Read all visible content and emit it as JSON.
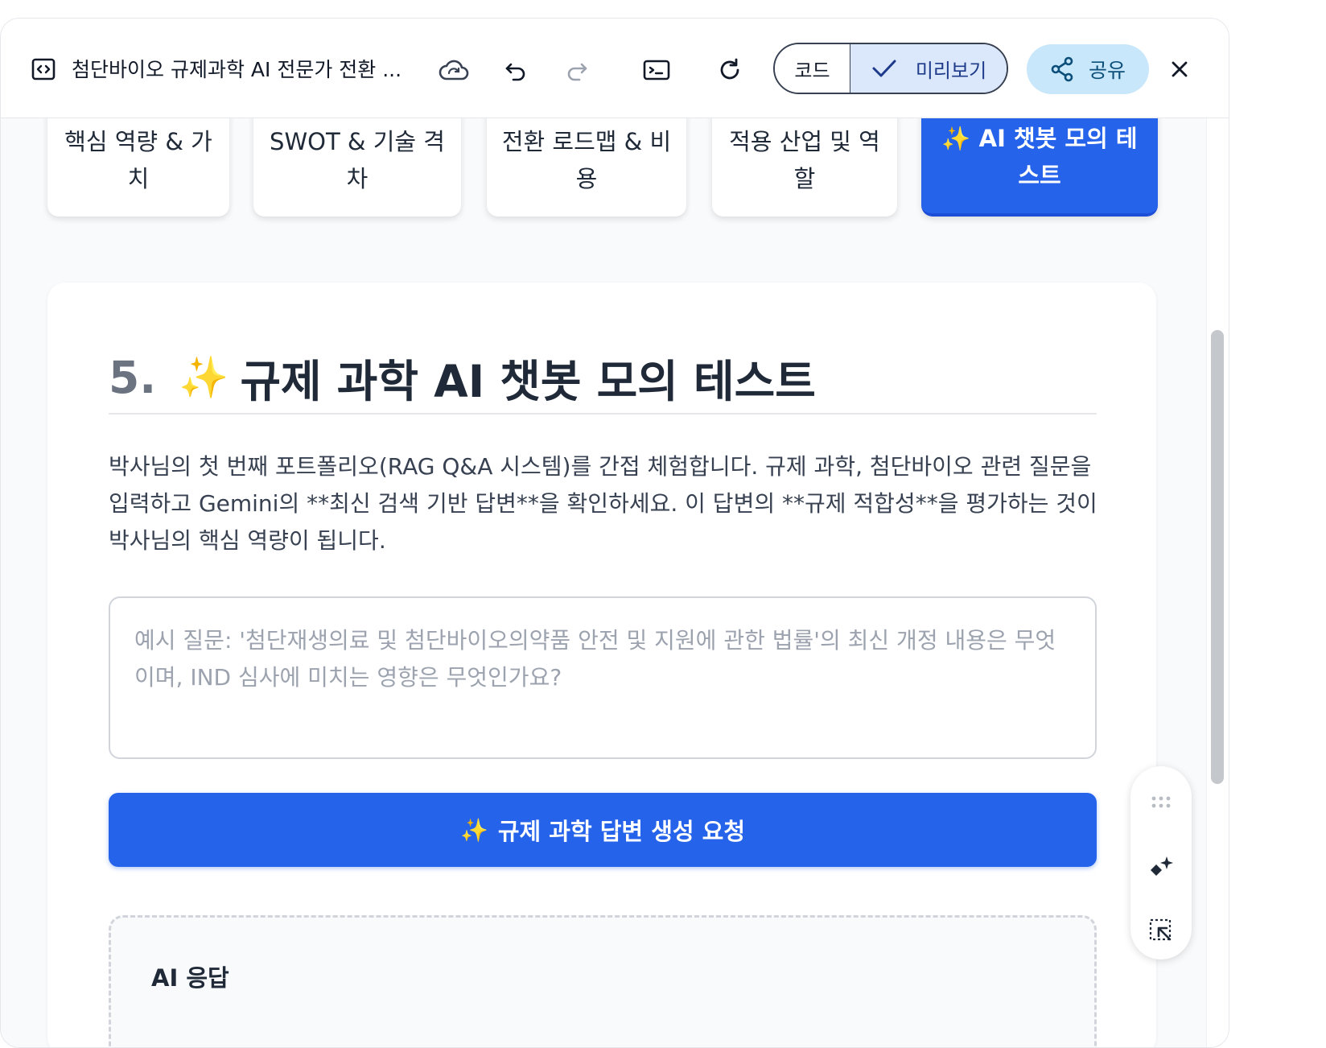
{
  "toolbar": {
    "doc_title": "첨단바이오 규제과학 AI 전문가 전환 ...",
    "code_label": "코드",
    "preview_label": "미리보기",
    "share_label": "공유"
  },
  "tabs": [
    {
      "label": "핵심 역량 & 가치"
    },
    {
      "label": "SWOT & 기술 격차"
    },
    {
      "label": "전환 로드맵 & 비용"
    },
    {
      "label": "적용 산업 및 역할"
    },
    {
      "label": "✨ AI 챗봇 모의 테스트",
      "active": true
    }
  ],
  "section": {
    "number": "5.",
    "sparkle": "✨",
    "title": "규제 과학 AI 챗봇 모의 테스트",
    "description": "박사님의 첫 번째 포트폴리오(RAG Q&A 시스템)를 간접 체험합니다. 규제 과학, 첨단바이오 관련 질문을 입력하고 Gemini의 **최신 검색 기반 답변**을 확인하세요. 이 답변의 **규제 적합성**을 평가하는 것이 박사님의 핵심 역량이 됩니다.",
    "input_placeholder": "예시 질문: '첨단재생의료 및 첨단바이오의약품 안전 및 지원에 관한 법률'의 최신 개정 내용은 무엇이며, IND 심사에 미치는 영향은 무엇인가요?",
    "generate_button_icon": "✨",
    "generate_button_label": "규제 과학 답변 생성 요청",
    "response_title": "AI 응답"
  },
  "colors": {
    "accent": "#2563eb",
    "preview_bg": "#dbe7fb",
    "share_bg": "#c9e7fb",
    "sparkle": "#f5b820"
  },
  "icons": [
    "code-file-icon",
    "cloud-sync-icon",
    "undo-icon",
    "redo-icon",
    "terminal-icon",
    "refresh-icon",
    "check-icon",
    "share-icon",
    "close-icon",
    "drag-handle-icon",
    "ai-sparkle-icon",
    "select-element-icon"
  ]
}
